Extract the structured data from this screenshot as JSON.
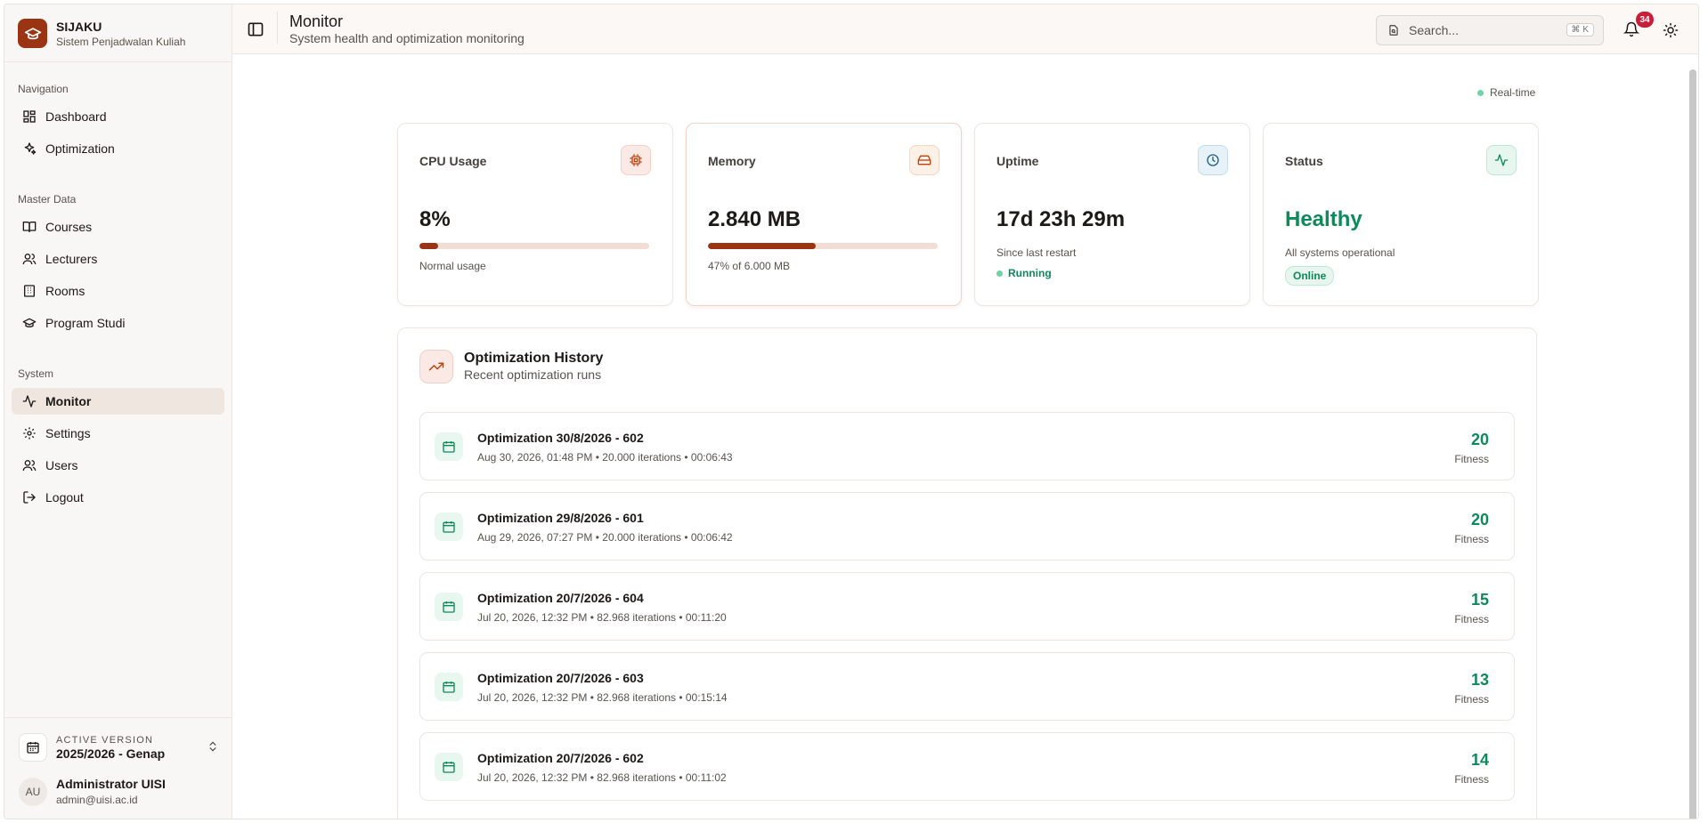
{
  "brand": {
    "title": "SIJAKU",
    "subtitle": "Sistem Penjadwalan Kuliah"
  },
  "sidebar": {
    "groups": [
      {
        "label": "Navigation",
        "items": [
          {
            "label": "Dashboard",
            "icon": "dashboard-icon"
          },
          {
            "label": "Optimization",
            "icon": "sparkles-icon"
          }
        ]
      },
      {
        "label": "Master Data",
        "items": [
          {
            "label": "Courses",
            "icon": "book-icon"
          },
          {
            "label": "Lecturers",
            "icon": "users-icon"
          },
          {
            "label": "Rooms",
            "icon": "building-icon"
          },
          {
            "label": "Program Studi",
            "icon": "graduation-cap-icon"
          }
        ]
      },
      {
        "label": "System",
        "items": [
          {
            "label": "Monitor",
            "icon": "activity-icon",
            "active": true
          },
          {
            "label": "Settings",
            "icon": "gear-icon"
          },
          {
            "label": "Users",
            "icon": "users-icon"
          },
          {
            "label": "Logout",
            "icon": "logout-icon"
          }
        ]
      }
    ],
    "version": {
      "label": "ACTIVE VERSION",
      "value": "2025/2026 - Genap"
    },
    "user": {
      "initials": "AU",
      "name": "Administrator UISI",
      "email": "admin@uisi.ac.id"
    }
  },
  "header": {
    "title": "Monitor",
    "subtitle": "System health and optimization monitoring",
    "search_placeholder": "Search...",
    "search_shortcut": "⌘ K",
    "notification_count": "34"
  },
  "main": {
    "realtime_label": "Real-time",
    "cards": {
      "cpu": {
        "label": "CPU Usage",
        "value": "8%",
        "progress": 0.08,
        "note": "Normal usage"
      },
      "memory": {
        "label": "Memory",
        "value": "2.840 MB",
        "progress": 0.47,
        "note": "47% of 6.000 MB"
      },
      "uptime": {
        "label": "Uptime",
        "value": "17d 23h 29m",
        "note": "Since last restart",
        "state": "Running"
      },
      "status": {
        "label": "Status",
        "value": "Healthy",
        "note": "All systems operational",
        "pill": "Online"
      }
    },
    "history": {
      "title": "Optimization History",
      "subtitle": "Recent optimization runs",
      "score_label": "Fitness",
      "runs": [
        {
          "title": "Optimization 30/8/2026 - 602",
          "meta": "Aug 30, 2026, 01:48 PM • 20.000 iterations • 00:06:43",
          "score": "20"
        },
        {
          "title": "Optimization 29/8/2026 - 601",
          "meta": "Aug 29, 2026, 07:27 PM • 20.000 iterations • 00:06:42",
          "score": "20"
        },
        {
          "title": "Optimization 20/7/2026 - 604",
          "meta": "Jul 20, 2026, 12:32 PM • 82.968 iterations • 00:11:20",
          "score": "15"
        },
        {
          "title": "Optimization 20/7/2026 - 603",
          "meta": "Jul 20, 2026, 12:32 PM • 82.968 iterations • 00:15:14",
          "score": "13"
        },
        {
          "title": "Optimization 20/7/2026 - 602",
          "meta": "Jul 20, 2026, 12:32 PM • 82.968 iterations • 00:11:02",
          "score": "14"
        }
      ]
    }
  },
  "colors": {
    "accent": "#9a3412",
    "success": "#0d8a5a",
    "badge": "#c81e3a"
  }
}
